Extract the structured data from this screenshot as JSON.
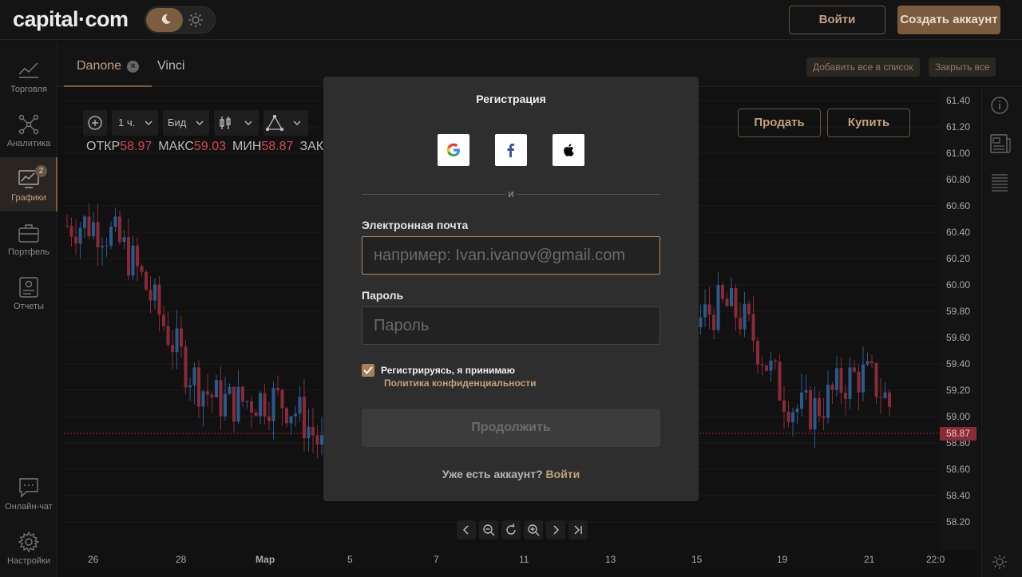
{
  "header": {
    "logo_text": "capital·com",
    "login_label": "Войти",
    "signup_label": "Создать аккаунт",
    "accent_color": "#7a5b3e"
  },
  "sidebar": {
    "items": [
      {
        "label": "Торговля",
        "icon": "trading-icon"
      },
      {
        "label": "Аналитика",
        "icon": "analytics-icon"
      },
      {
        "label": "Графики",
        "icon": "charts-icon",
        "badge": "2",
        "active": true
      },
      {
        "label": "Портфель",
        "icon": "portfolio-icon"
      },
      {
        "label": "Отчеты",
        "icon": "reports-icon"
      }
    ],
    "bottom": [
      {
        "label": "Онлайн-чат",
        "icon": "chat-icon"
      },
      {
        "label": "Настройки",
        "icon": "settings-icon"
      }
    ]
  },
  "tabs": {
    "items": [
      {
        "label": "Danone",
        "active": true
      },
      {
        "label": "Vinci",
        "active": false
      }
    ],
    "add_all_label": "Добавить все в список",
    "close_all_label": "Закрыть все"
  },
  "chart": {
    "interval": "1 ч.",
    "price_type": "Бид",
    "ohlc": {
      "open_label": "ОТКР",
      "open": "58.97",
      "high_label": "МАКС",
      "high": "59.03",
      "low_label": "МИН",
      "low": "58.87",
      "close_label": "ЗАК"
    },
    "sell_label": "Продать",
    "buy_label": "Купить",
    "current_price": "58.87",
    "y_ticks": [
      "61.40",
      "61.20",
      "61.00",
      "60.80",
      "60.60",
      "60.40",
      "60.20",
      "60.00",
      "59.80",
      "59.60",
      "59.40",
      "59.20",
      "59.00",
      "58.80",
      "58.60",
      "58.40",
      "58.20"
    ],
    "x_ticks": [
      "26",
      "28",
      "Мар",
      "5",
      "7",
      "11",
      "13",
      "15",
      "19",
      "21",
      "22:0"
    ],
    "up_color": "#2a5a8c",
    "down_color": "#8b2a36"
  },
  "modal": {
    "title": "Регистрация",
    "divider_text": "и",
    "email_label": "Электронная почта",
    "email_placeholder": "например: Ivan.ivanov@gmail.com",
    "password_label": "Пароль",
    "password_placeholder": "Пароль",
    "consent_text": "Регистрируясь, я принимаю",
    "policy_link": "Политика конфиденциальности",
    "continue_label": "Продолжить",
    "have_account_text": "Уже есть аккаунт?",
    "login_link": "Войти"
  }
}
